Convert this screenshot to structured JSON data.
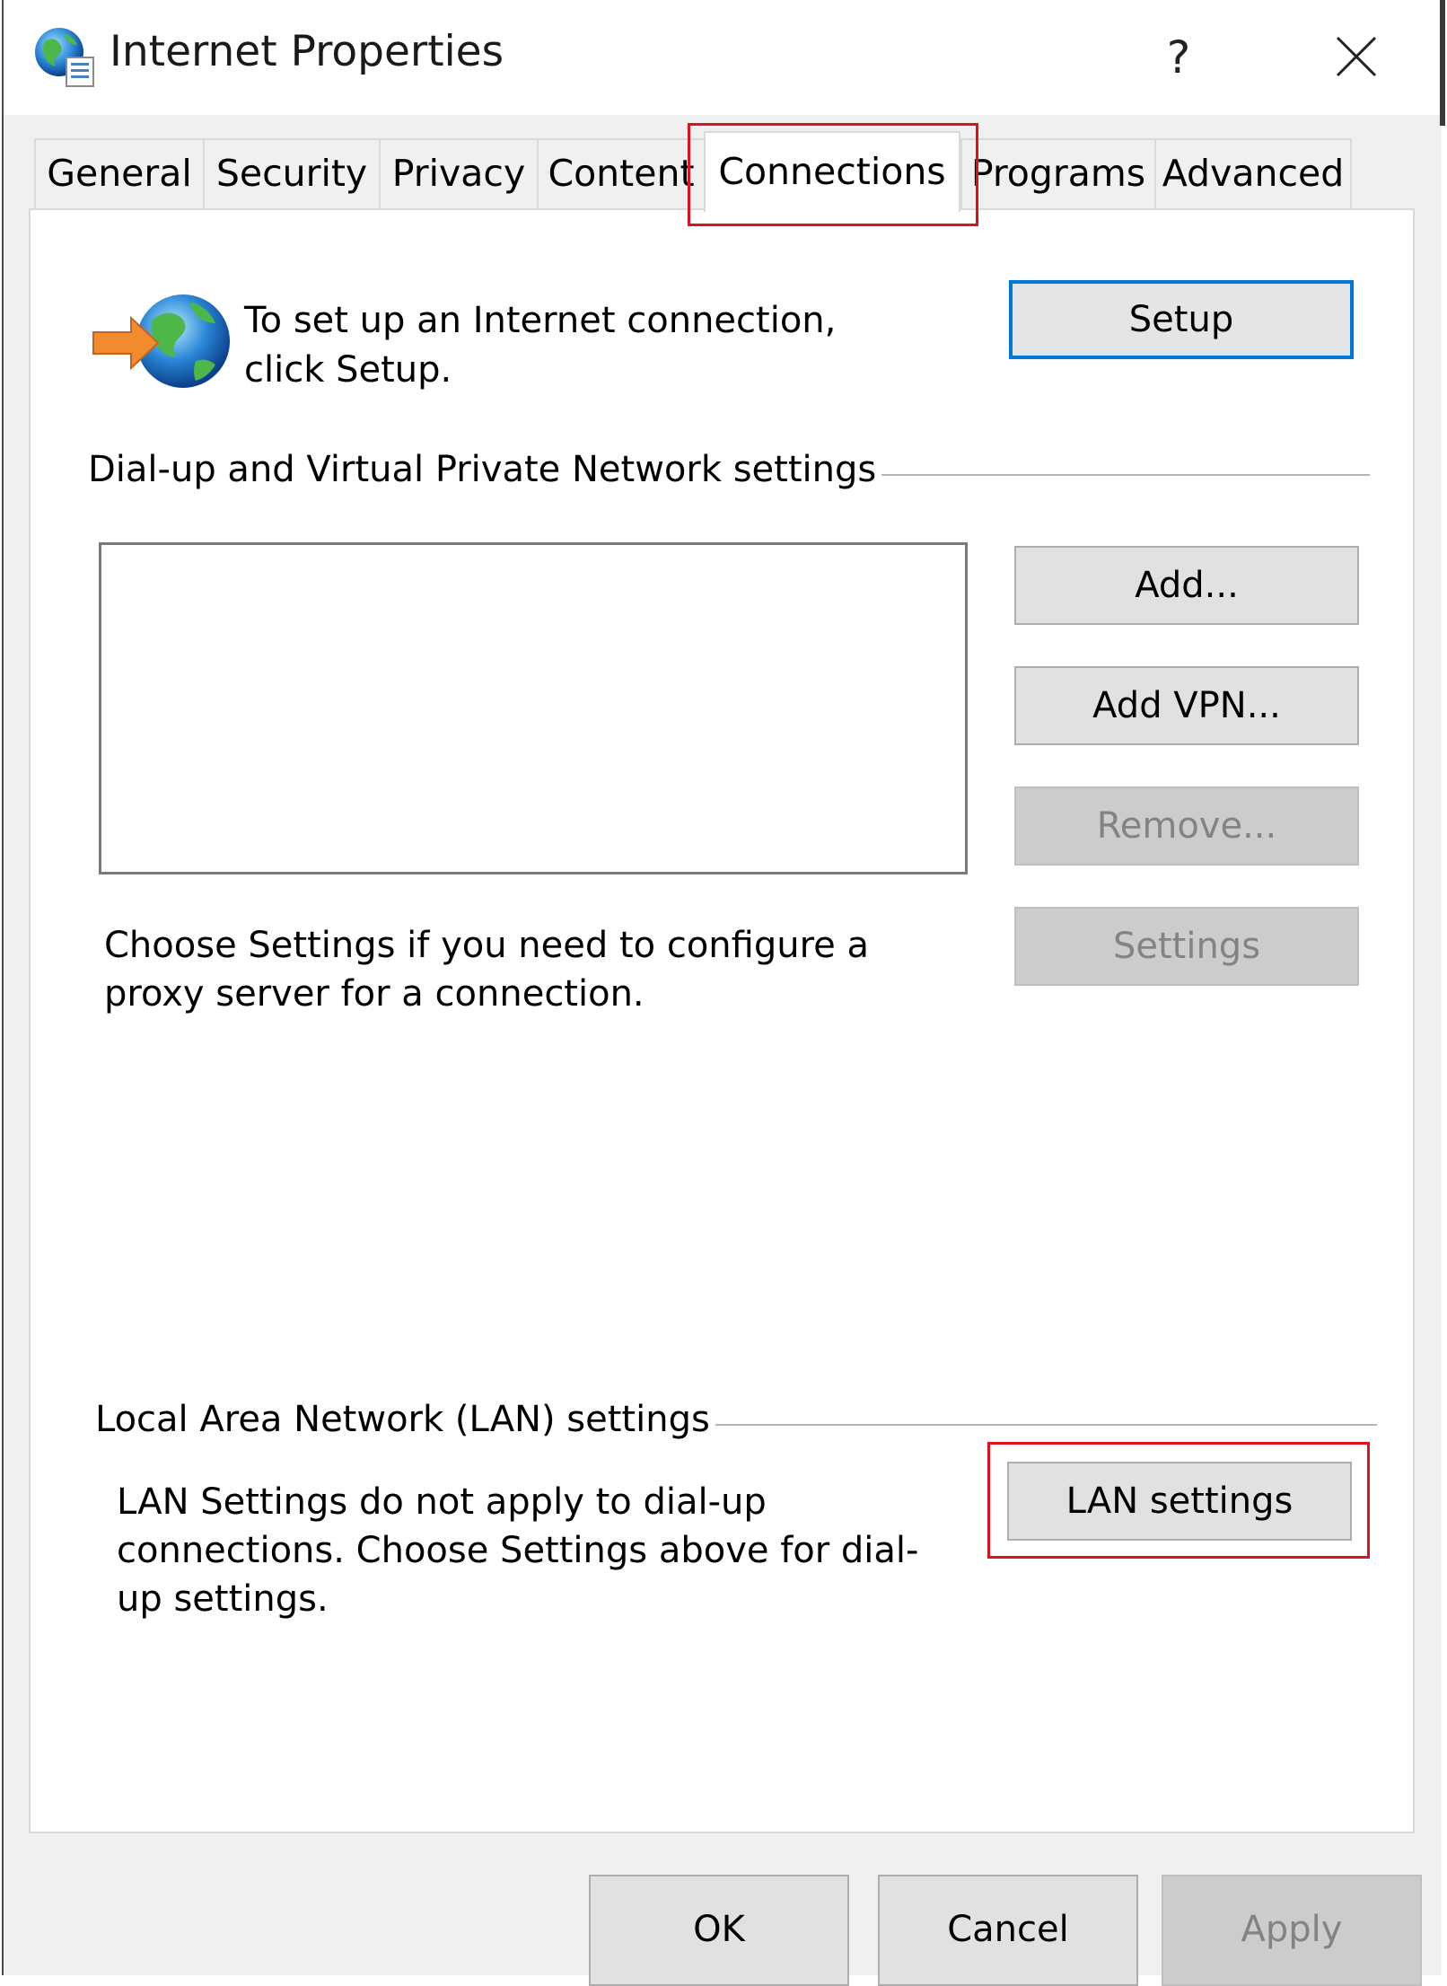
{
  "window": {
    "title": "Internet Properties",
    "help": "?"
  },
  "tabs": [
    {
      "label": "General"
    },
    {
      "label": "Security"
    },
    {
      "label": "Privacy"
    },
    {
      "label": "Content"
    },
    {
      "label": "Connections"
    },
    {
      "label": "Programs"
    },
    {
      "label": "Advanced"
    }
  ],
  "setup": {
    "description": "To set up an Internet connection, click Setup.",
    "button": "Setup"
  },
  "dialup": {
    "group_label": "Dial-up and Virtual Private Network settings",
    "add": "Add...",
    "add_vpn": "Add VPN...",
    "remove": "Remove...",
    "settings": "Settings",
    "proxy_text": "Choose Settings if you need to configure a proxy server for a connection."
  },
  "lan": {
    "group_label": "Local Area Network (LAN) settings",
    "description": "LAN Settings do not apply to dial-up connections. Choose Settings above for dial-up settings.",
    "button": "LAN settings"
  },
  "footer": {
    "ok": "OK",
    "cancel": "Cancel",
    "apply": "Apply"
  },
  "colors": {
    "highlight": "#e0101c",
    "focus": "#0078d7"
  }
}
